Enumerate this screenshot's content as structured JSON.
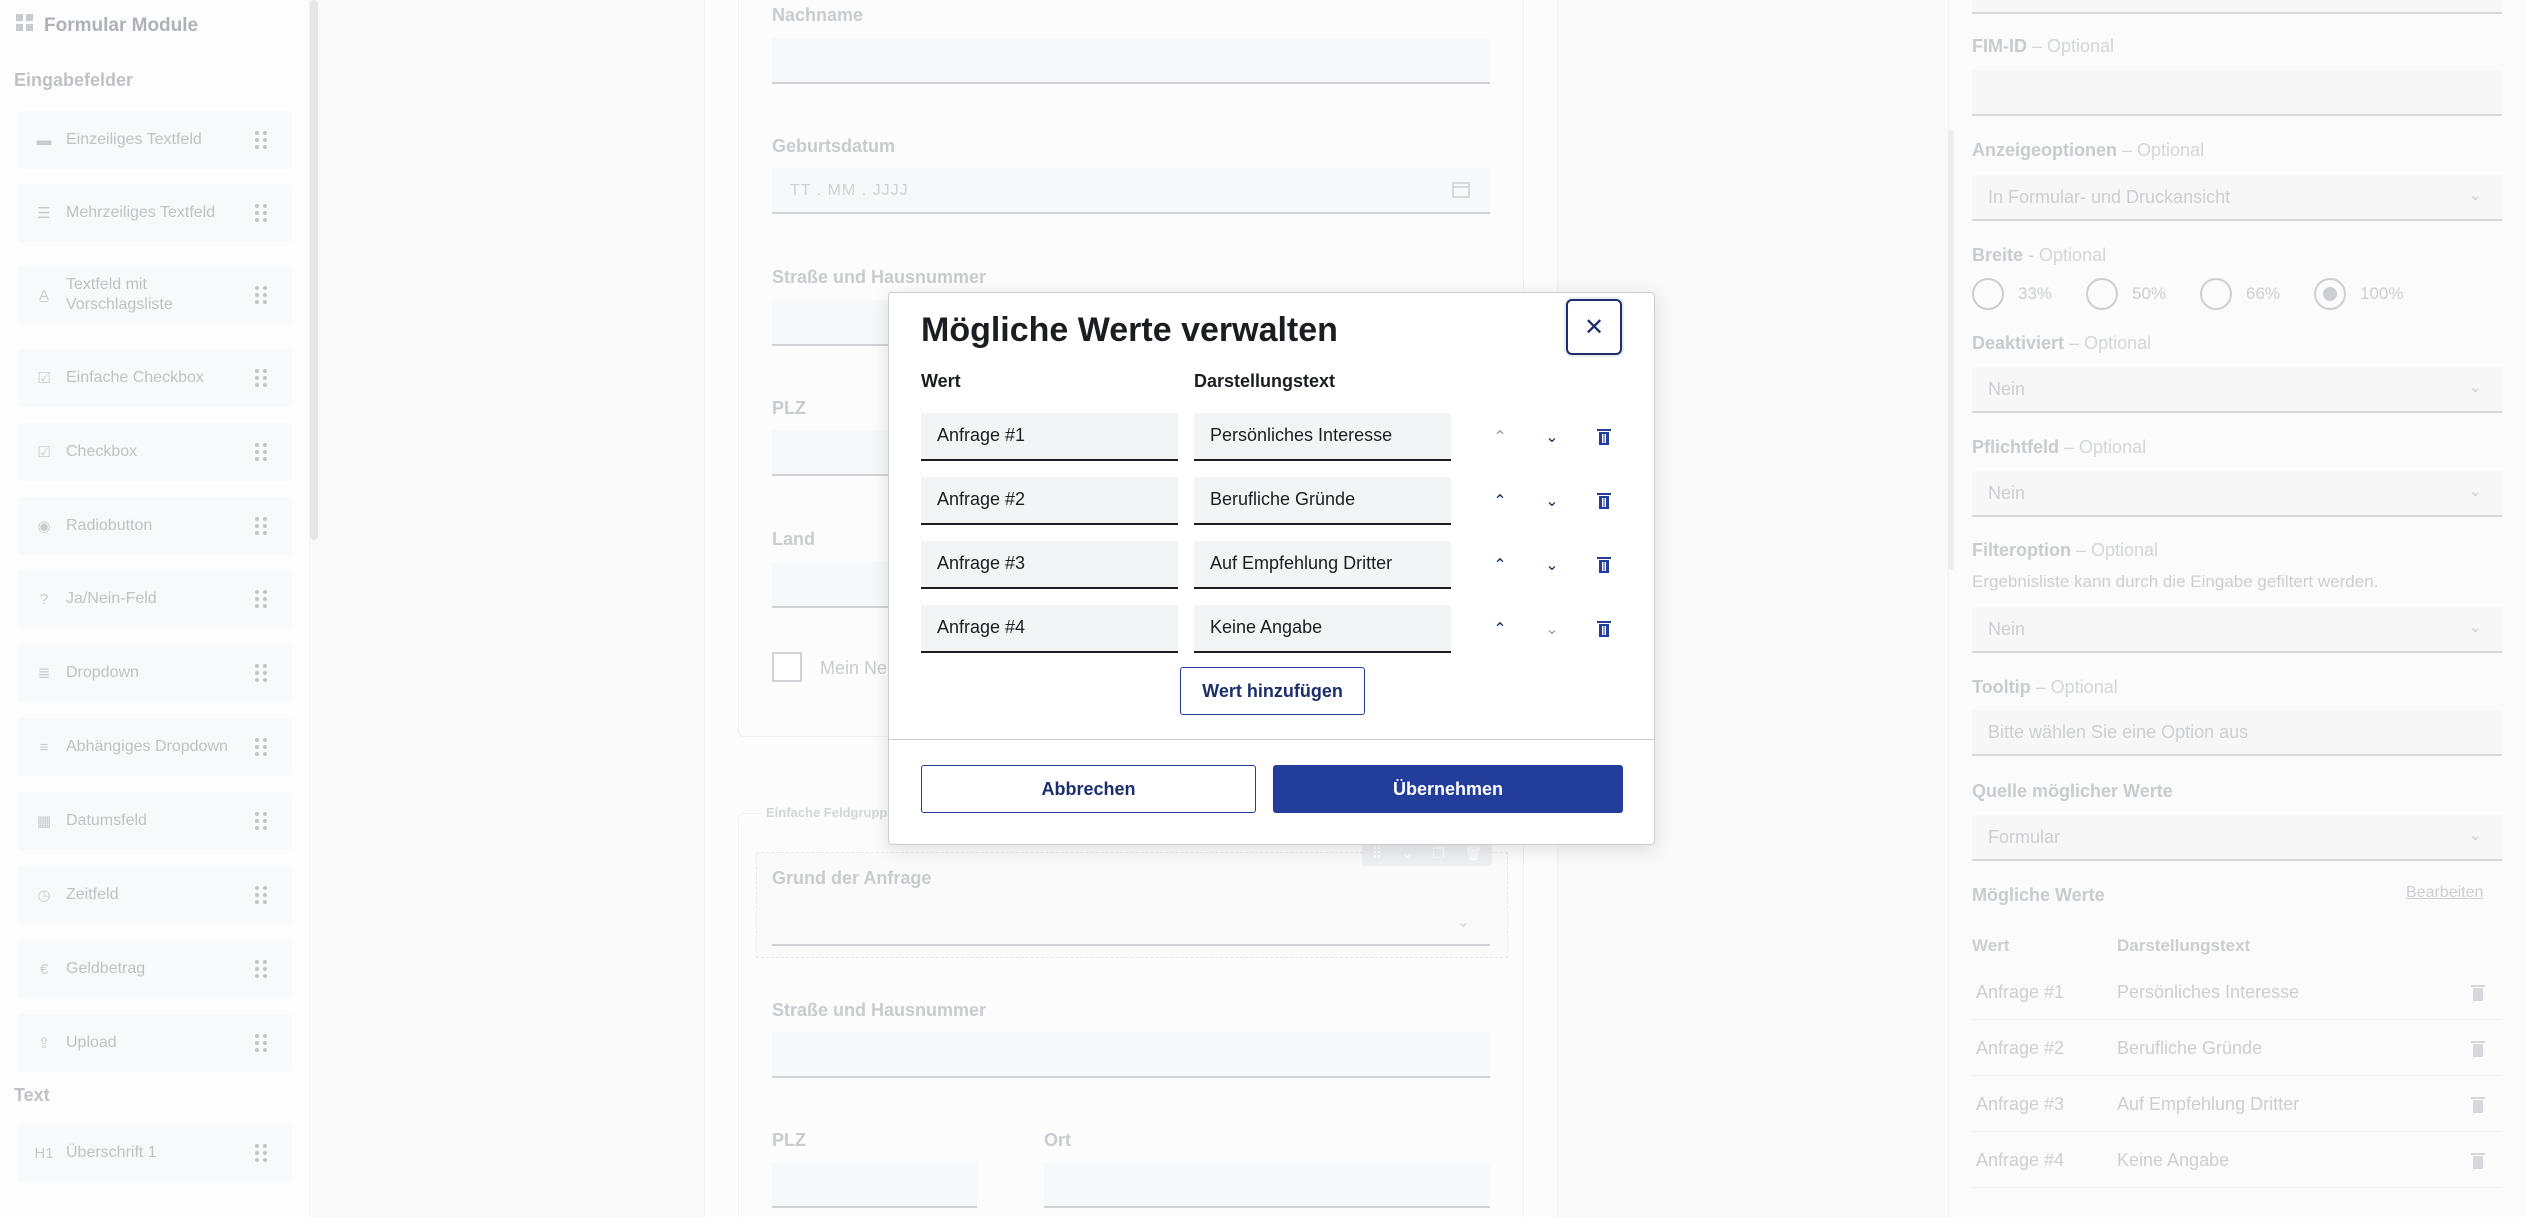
{
  "sidebar": {
    "header": "Formular Module",
    "section_fields": "Eingabefelder",
    "section_text": "Text",
    "items": [
      {
        "label": "Einzeiliges Textfeld",
        "icon": "single-line-icon"
      },
      {
        "label": "Mehrzeiliges Textfeld",
        "icon": "multi-line-icon"
      },
      {
        "label": "Textfeld mit Vorschlagsliste",
        "icon": "suggest-icon"
      },
      {
        "label": "Einfache Checkbox",
        "icon": "checkbox-icon"
      },
      {
        "label": "Checkbox",
        "icon": "checkbox-multi-icon"
      },
      {
        "label": "Radiobutton",
        "icon": "radio-icon"
      },
      {
        "label": "Ja/Nein-Feld",
        "icon": "help-icon"
      },
      {
        "label": "Dropdown",
        "icon": "list-icon"
      },
      {
        "label": "Abhängiges Dropdown",
        "icon": "dependent-list-icon"
      },
      {
        "label": "Datumsfeld",
        "icon": "calendar-icon"
      },
      {
        "label": "Zeitfeld",
        "icon": "clock-icon"
      },
      {
        "label": "Geldbetrag",
        "icon": "euro-icon"
      },
      {
        "label": "Upload",
        "icon": "upload-icon"
      }
    ],
    "text_items": [
      {
        "label": "Überschrift 1",
        "icon": "h1-icon"
      }
    ]
  },
  "canvas": {
    "nachname_label": "Nachname",
    "geburtsdatum_label": "Geburtsdatum",
    "geburtsdatum_placeholder": "TT . MM . JJJJ",
    "strasse_label": "Straße und Hausnummer",
    "plz_label": "PLZ",
    "land_label": "Land",
    "checkbox_label": "Mein Ne",
    "group_title": "Einfache Feldgruppe",
    "grund_label": "Grund der Anfrage",
    "strasse2_label": "Straße und Hausnummer",
    "plz2_label": "PLZ",
    "ort_label": "Ort"
  },
  "right_panel": {
    "fim_label": "FIM-ID",
    "optional": "– Optional",
    "optional_dash": "- Optional",
    "anzeige_label": "Anzeigeoptionen",
    "anzeige_value": "In Formular- und Druckansicht",
    "breite_label": "Breite",
    "breite_options": [
      "33%",
      "50%",
      "66%",
      "100%"
    ],
    "breite_selected": "100%",
    "deaktiviert_label": "Deaktiviert",
    "deaktiviert_value": "Nein",
    "pflicht_label": "Pflichtfeld",
    "pflicht_value": "Nein",
    "filter_label": "Filteroption",
    "filter_hint": "Ergebnisliste kann durch die Eingabe gefiltert werden.",
    "filter_value": "Nein",
    "tooltip_label": "Tooltip",
    "tooltip_value": "Bitte wählen Sie eine Option aus",
    "quelle_label": "Quelle möglicher Werte",
    "quelle_value": "Formular",
    "werte_label": "Mögliche Werte",
    "werte_edit": "Bearbeiten",
    "col_wert": "Wert",
    "col_text": "Darstellungstext",
    "rows": [
      {
        "wert": "Anfrage #1",
        "text": "Persönliches Interesse"
      },
      {
        "wert": "Anfrage #2",
        "text": "Berufliche Gründe"
      },
      {
        "wert": "Anfrage #3",
        "text": "Auf Empfehlung Dritter"
      },
      {
        "wert": "Anfrage #4",
        "text": "Keine Angabe"
      }
    ]
  },
  "modal": {
    "title": "Mögliche Werte verwalten",
    "col_wert": "Wert",
    "col_text": "Darstellungstext",
    "rows": [
      {
        "wert": "Anfrage #1",
        "text": "Persönliches Interesse"
      },
      {
        "wert": "Anfrage #2",
        "text": "Berufliche Gründe"
      },
      {
        "wert": "Anfrage #3",
        "text": "Auf Empfehlung Dritter"
      },
      {
        "wert": "Anfrage #4",
        "text": "Keine Angabe"
      }
    ],
    "add_label": "Wert hinzufügen",
    "cancel_label": "Abbrechen",
    "apply_label": "Übernehmen",
    "accent_color": "#233d9b"
  }
}
